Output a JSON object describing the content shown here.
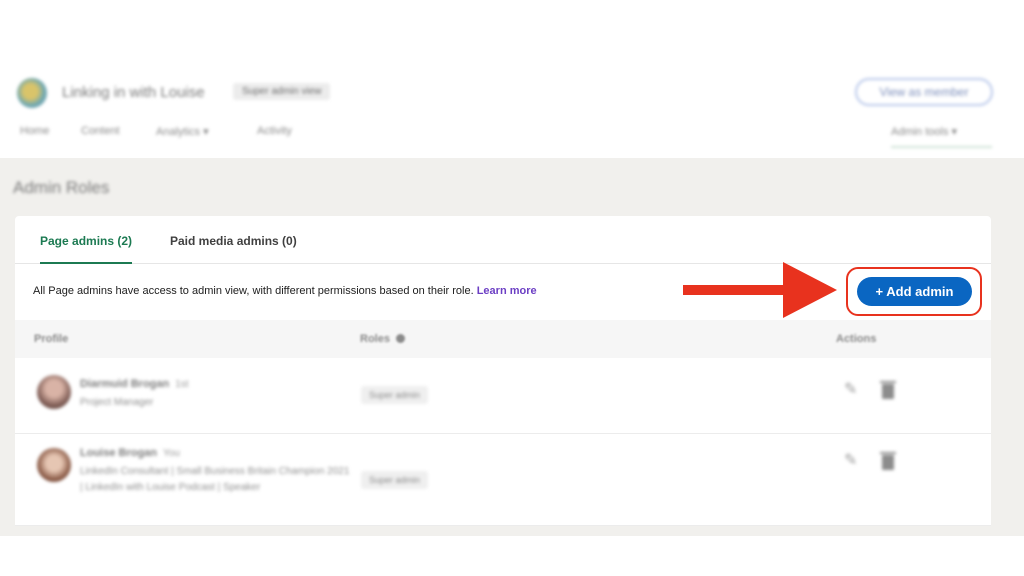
{
  "header": {
    "page_name": "Linking in with Louise",
    "badge": "Super admin view",
    "view_as_member": "View as member"
  },
  "nav": {
    "items": [
      "Home",
      "Content",
      "Analytics ▾",
      "Activity"
    ],
    "admin_tools": "Admin tools ▾"
  },
  "section": {
    "title": "Admin Roles"
  },
  "tabs": [
    {
      "label": "Page admins (2)",
      "active": true
    },
    {
      "label": "Paid media admins (0)",
      "active": false
    }
  ],
  "info": {
    "text": "All Page admins have access to admin view, with different permissions based on their role.",
    "link": "Learn more"
  },
  "add_admin_label": "+ Add admin",
  "table": {
    "headers": {
      "profile": "Profile",
      "roles": "Roles",
      "actions": "Actions"
    },
    "rows": [
      {
        "name": "Diarmuid Brogan",
        "degree": "1st",
        "headline": "Project Manager",
        "role": "Super admin"
      },
      {
        "name": "Louise Brogan",
        "degree": "You",
        "headline": "LinkedIn Consultant | Small Business Britain Champion 2021 | LinkedIn with Louise Podcast | Speaker",
        "role": "Super admin"
      }
    ]
  },
  "colors": {
    "accent_green": "#1c7a52",
    "primary_blue": "#0a66c2",
    "annotation_red": "#e8321e",
    "link_purple": "#6c3fc4"
  }
}
